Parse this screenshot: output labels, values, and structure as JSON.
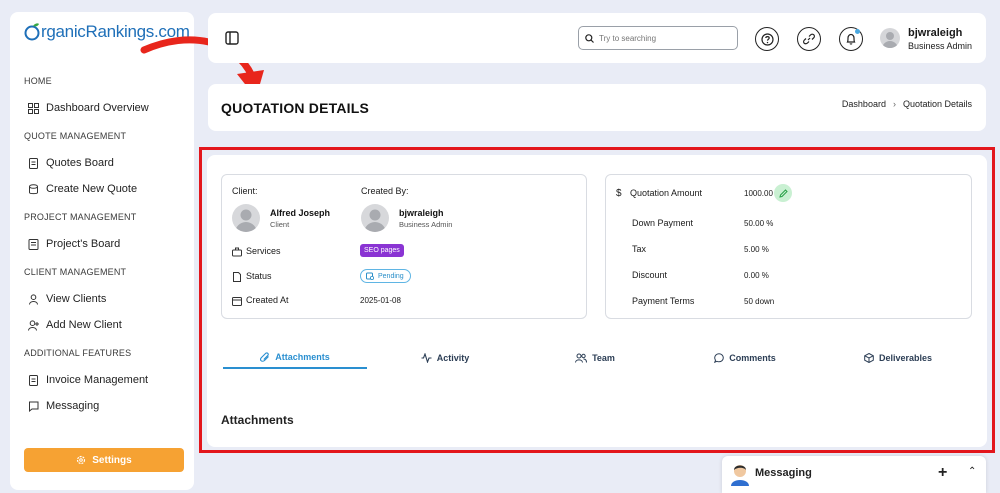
{
  "brand": {
    "logo_text": "rganicRankings.com",
    "logo_letter": "O"
  },
  "sidebar": {
    "sections": [
      {
        "title": "HOME",
        "items": [
          {
            "label": "Dashboard Overview",
            "icon": "grid-icon"
          }
        ]
      },
      {
        "title": "QUOTE MANAGEMENT",
        "items": [
          {
            "label": "Quotes Board",
            "icon": "file-icon"
          },
          {
            "label": "Create New Quote",
            "icon": "database-icon"
          }
        ]
      },
      {
        "title": "PROJECT MANAGEMENT",
        "items": [
          {
            "label": "Project's Board",
            "icon": "board-icon"
          }
        ]
      },
      {
        "title": "CLIENT MANAGEMENT",
        "items": [
          {
            "label": "View Clients",
            "icon": "user-icon"
          },
          {
            "label": "Add New Client",
            "icon": "user-plus-icon"
          }
        ]
      },
      {
        "title": "ADDITIONAL FEATURES",
        "items": [
          {
            "label": "Invoice Management",
            "icon": "file-icon"
          },
          {
            "label": "Messaging",
            "icon": "chat-icon"
          }
        ]
      }
    ],
    "settings_label": "Settings"
  },
  "header": {
    "search_placeholder": "Try to searching",
    "user_name": "bjwraleigh",
    "user_role": "Business Admin"
  },
  "page": {
    "title": "QUOTATION DETAILS",
    "breadcrumb": [
      "Dashboard",
      "Quotation Details"
    ]
  },
  "details": {
    "client_label": "Client:",
    "created_by_label": "Created By:",
    "client_name": "Alfred Joseph",
    "client_role": "Client",
    "creator_name": "bjwraleigh",
    "creator_role": "Business Admin",
    "services_label": "Services",
    "services_value": "SEO pages",
    "status_label": "Status",
    "status_value": "Pending",
    "created_at_label": "Created At",
    "created_at_value": "2025-01-08"
  },
  "amounts": {
    "quotation_amount_label": "Quotation Amount",
    "quotation_amount_value": "1000.00",
    "down_payment_label": "Down Payment",
    "down_payment_value": "50.00 %",
    "tax_label": "Tax",
    "tax_value": "5.00 %",
    "discount_label": "Discount",
    "discount_value": "0.00 %",
    "payment_terms_label": "Payment Terms",
    "payment_terms_value": "50 down"
  },
  "tabs": [
    {
      "label": "Attachments",
      "icon": "paperclip-icon",
      "active": true
    },
    {
      "label": "Activity",
      "icon": "activity-icon",
      "active": false
    },
    {
      "label": "Team",
      "icon": "team-icon",
      "active": false
    },
    {
      "label": "Comments",
      "icon": "comment-icon",
      "active": false
    },
    {
      "label": "Deliverables",
      "icon": "box-icon",
      "active": false
    }
  ],
  "section_title": "Attachments",
  "messaging": {
    "label": "Messaging"
  },
  "colors": {
    "accent": "#2a8fd0",
    "settings": "#f6a233",
    "highlight": "#e3161c",
    "seo_tag": "#8a34d3"
  }
}
